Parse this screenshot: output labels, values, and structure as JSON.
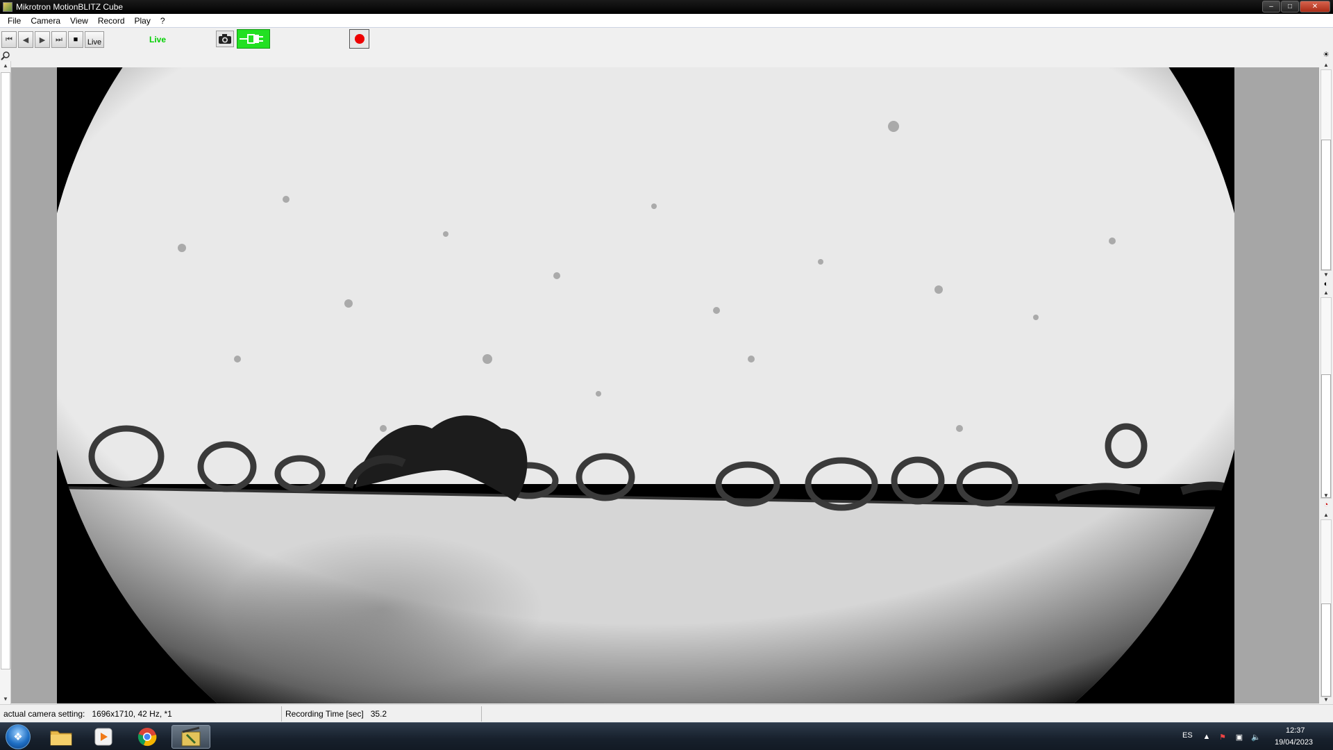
{
  "window": {
    "title": "Mikrotron MotionBLITZ Cube",
    "controls": {
      "minimize": "–",
      "maximize": "□",
      "close": "✕"
    }
  },
  "menu": [
    "File",
    "Camera",
    "View",
    "Record",
    "Play",
    "?"
  ],
  "toolbar": {
    "live_button_label": "Live",
    "live_status": "Live",
    "icons": [
      "skip-to-start-icon",
      "step-back-icon",
      "play-icon",
      "step-forward-icon",
      "stop-icon",
      "camera-icon",
      "plug-icon",
      "record-icon"
    ]
  },
  "status": {
    "camera_setting_label": "actual camera setting:",
    "camera_setting_value": "1696x1710, 42 Hz, *1",
    "recording_time_label": "Recording Time [sec]",
    "recording_time_value": "35.2"
  },
  "taskbar": {
    "apps": [
      "file-explorer-icon",
      "media-player-icon",
      "chrome-icon",
      "motionblitz-icon"
    ],
    "language": "ES",
    "time": "12:37",
    "date": "19/04/2023"
  }
}
